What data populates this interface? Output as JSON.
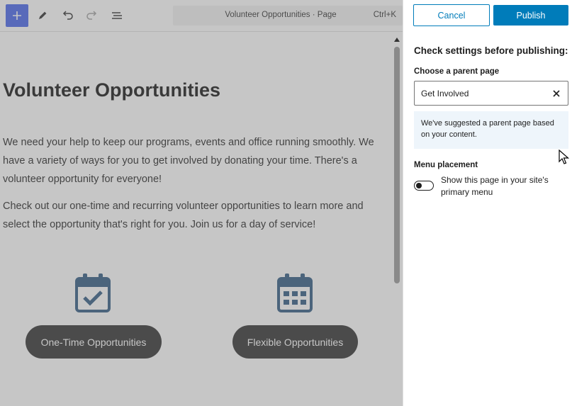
{
  "toolbar": {
    "add_icon": "plus-icon",
    "edit_icon": "pencil-icon",
    "undo_icon": "undo-icon",
    "redo_icon": "redo-icon",
    "list_icon": "list-view-icon"
  },
  "command_bar": {
    "title": "Volunteer Opportunities · Page",
    "shortcut": "Ctrl+K"
  },
  "content": {
    "title": "Volunteer Opportunities",
    "paragraph1": "We need your help to keep our programs, events and office running smoothly. We have a variety of ways for you to get involved by donating your time. There's a volunteer opportunity for everyone!",
    "paragraph2": "Check out our one-time and recurring volunteer opportunities to learn more and select the opportunity that's right for you. Join us for a day of service!",
    "buttons": [
      {
        "label": "One-Time Opportunities",
        "icon": "calendar-check-icon"
      },
      {
        "label": "Flexible Opportunities",
        "icon": "calendar-grid-icon"
      }
    ]
  },
  "panel": {
    "cancel_label": "Cancel",
    "publish_label": "Publish",
    "heading": "Check settings before publishing:",
    "parent_label": "Choose a parent page",
    "parent_value": "Get Involved",
    "notice": "We've suggested a parent page based on your content.",
    "menu_label": "Menu placement",
    "menu_toggle_text": "Show this page in your site's primary menu",
    "menu_toggle_on": false
  },
  "colors": {
    "accent": "#007cba",
    "wp_blue": "#3858e9",
    "icon_blue": "#1f4e79",
    "pill_bg": "#202020"
  }
}
